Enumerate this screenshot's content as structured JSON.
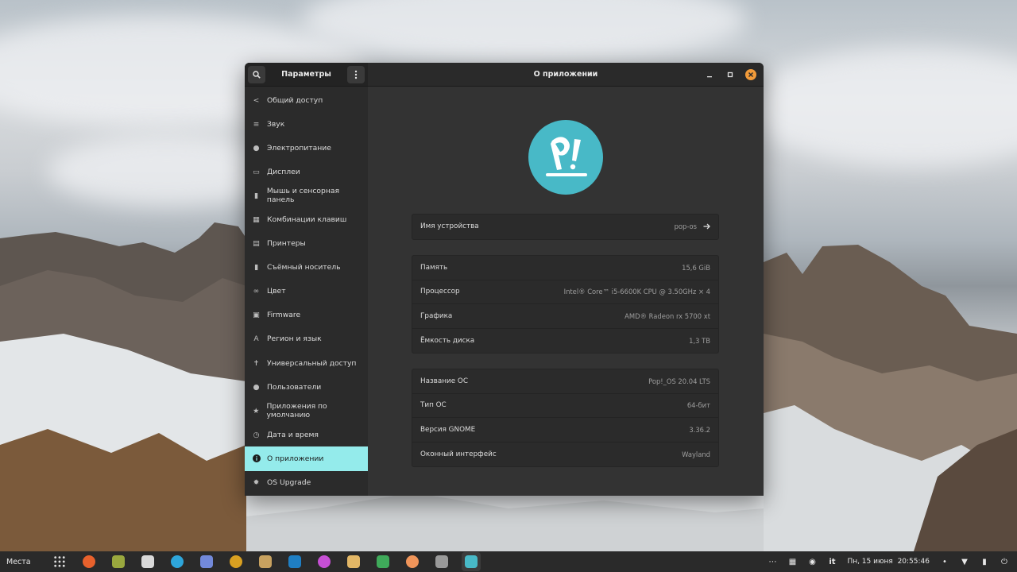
{
  "window": {
    "sidebar_title": "Параметры",
    "main_title": "О приложении"
  },
  "sidebar": {
    "items": [
      {
        "label": "Общий доступ",
        "icon": "share-icon"
      },
      {
        "label": "Звук",
        "icon": "sound-icon"
      },
      {
        "label": "Электропитание",
        "icon": "power-icon"
      },
      {
        "label": "Дисплеи",
        "icon": "display-icon"
      },
      {
        "label": "Мышь и сенсорная панель",
        "icon": "mouse-icon"
      },
      {
        "label": "Комбинации клавиш",
        "icon": "keyboard-icon"
      },
      {
        "label": "Принтеры",
        "icon": "printer-icon"
      },
      {
        "label": "Съёмный носитель",
        "icon": "removable-media-icon"
      },
      {
        "label": "Цвет",
        "icon": "color-icon"
      },
      {
        "label": "Firmware",
        "icon": "firmware-icon"
      },
      {
        "label": "Регион и язык",
        "icon": "region-icon"
      },
      {
        "label": "Универсальный доступ",
        "icon": "accessibility-icon"
      },
      {
        "label": "Пользователи",
        "icon": "users-icon"
      },
      {
        "label": "Приложения по умолчанию",
        "icon": "star-icon"
      },
      {
        "label": "Дата и время",
        "icon": "clock-icon"
      },
      {
        "label": "О приложении",
        "icon": "info-icon"
      },
      {
        "label": "OS Upgrade",
        "icon": "gear-icon"
      }
    ],
    "active_index": 15
  },
  "device": {
    "label": "Имя устройства",
    "value": "pop-os"
  },
  "hardware": [
    {
      "label": "Память",
      "value": "15,6 GiB"
    },
    {
      "label": "Процессор",
      "value": "Intel® Core™ i5-6600K CPU @ 3.50GHz × 4"
    },
    {
      "label": "Графика",
      "value": "AMD® Radeon rx 5700 xt"
    },
    {
      "label": "Ёмкость диска",
      "value": "1,3 TB"
    }
  ],
  "os": [
    {
      "label": "Название ОС",
      "value": "Pop!_OS 20.04 LTS"
    },
    {
      "label": "Тип ОС",
      "value": "64-бит"
    },
    {
      "label": "Версия GNOME",
      "value": "3.36.2"
    },
    {
      "label": "Оконный интерфейс",
      "value": "Wayland"
    }
  ],
  "taskbar": {
    "places": "Места",
    "lang": "it",
    "datetime": "Пн, 15 июня  20:55:46",
    "apps": [
      {
        "name": "app-grid-icon",
        "color": "#2a2a2a"
      },
      {
        "name": "firefox-icon",
        "color": "#e8612c"
      },
      {
        "name": "files-icon",
        "color": "#9aa83e"
      },
      {
        "name": "archive-icon",
        "color": "#d9d9d9"
      },
      {
        "name": "telegram-icon",
        "color": "#2ea6db"
      },
      {
        "name": "discord-icon",
        "color": "#7289da"
      },
      {
        "name": "headphones-icon",
        "color": "#d9a021"
      },
      {
        "name": "document-icon",
        "color": "#c8a260"
      },
      {
        "name": "steam-icon",
        "color": "#1f7fc4"
      },
      {
        "name": "color-picker-icon",
        "color": "#c64fd4"
      },
      {
        "name": "package-icon",
        "color": "#e3b766"
      },
      {
        "name": "folder-icon",
        "color": "#3faa5a"
      },
      {
        "name": "tool-icon",
        "color": "#f0955a"
      },
      {
        "name": "system-monitor-icon",
        "color": "#9a9a9a"
      },
      {
        "name": "settings-app-icon",
        "color": "#48b9c7"
      }
    ]
  }
}
